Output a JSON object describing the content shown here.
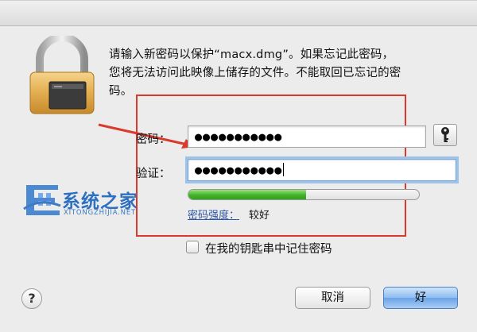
{
  "message": {
    "line1": "请输入新密码以保护“macx.dmg”。如果忘记此密码，",
    "line2": "您将无法访问此映像上储存的文件。不能取回已忘记的密",
    "line3": "码。"
  },
  "password": {
    "label": "密码：",
    "value": "●●●●●●●●●●●"
  },
  "verify": {
    "label": "验证：",
    "value": "●●●●●●●●●●●"
  },
  "strength": {
    "link_label": "密码强度：",
    "value_label": "较好",
    "level": 0.51
  },
  "keychain": {
    "label": "在我的钥匙串中记住密码",
    "checked": false
  },
  "buttons": {
    "help_label": "?",
    "cancel_label": "取消",
    "ok_label": "好"
  },
  "watermark": {
    "title": "系统之家",
    "subtitle": "XITONGZHIJIA.NET"
  },
  "colors": {
    "annotation_red": "#d93a2b",
    "strength_green": "#40b227",
    "link_blue": "#2d55a6"
  }
}
